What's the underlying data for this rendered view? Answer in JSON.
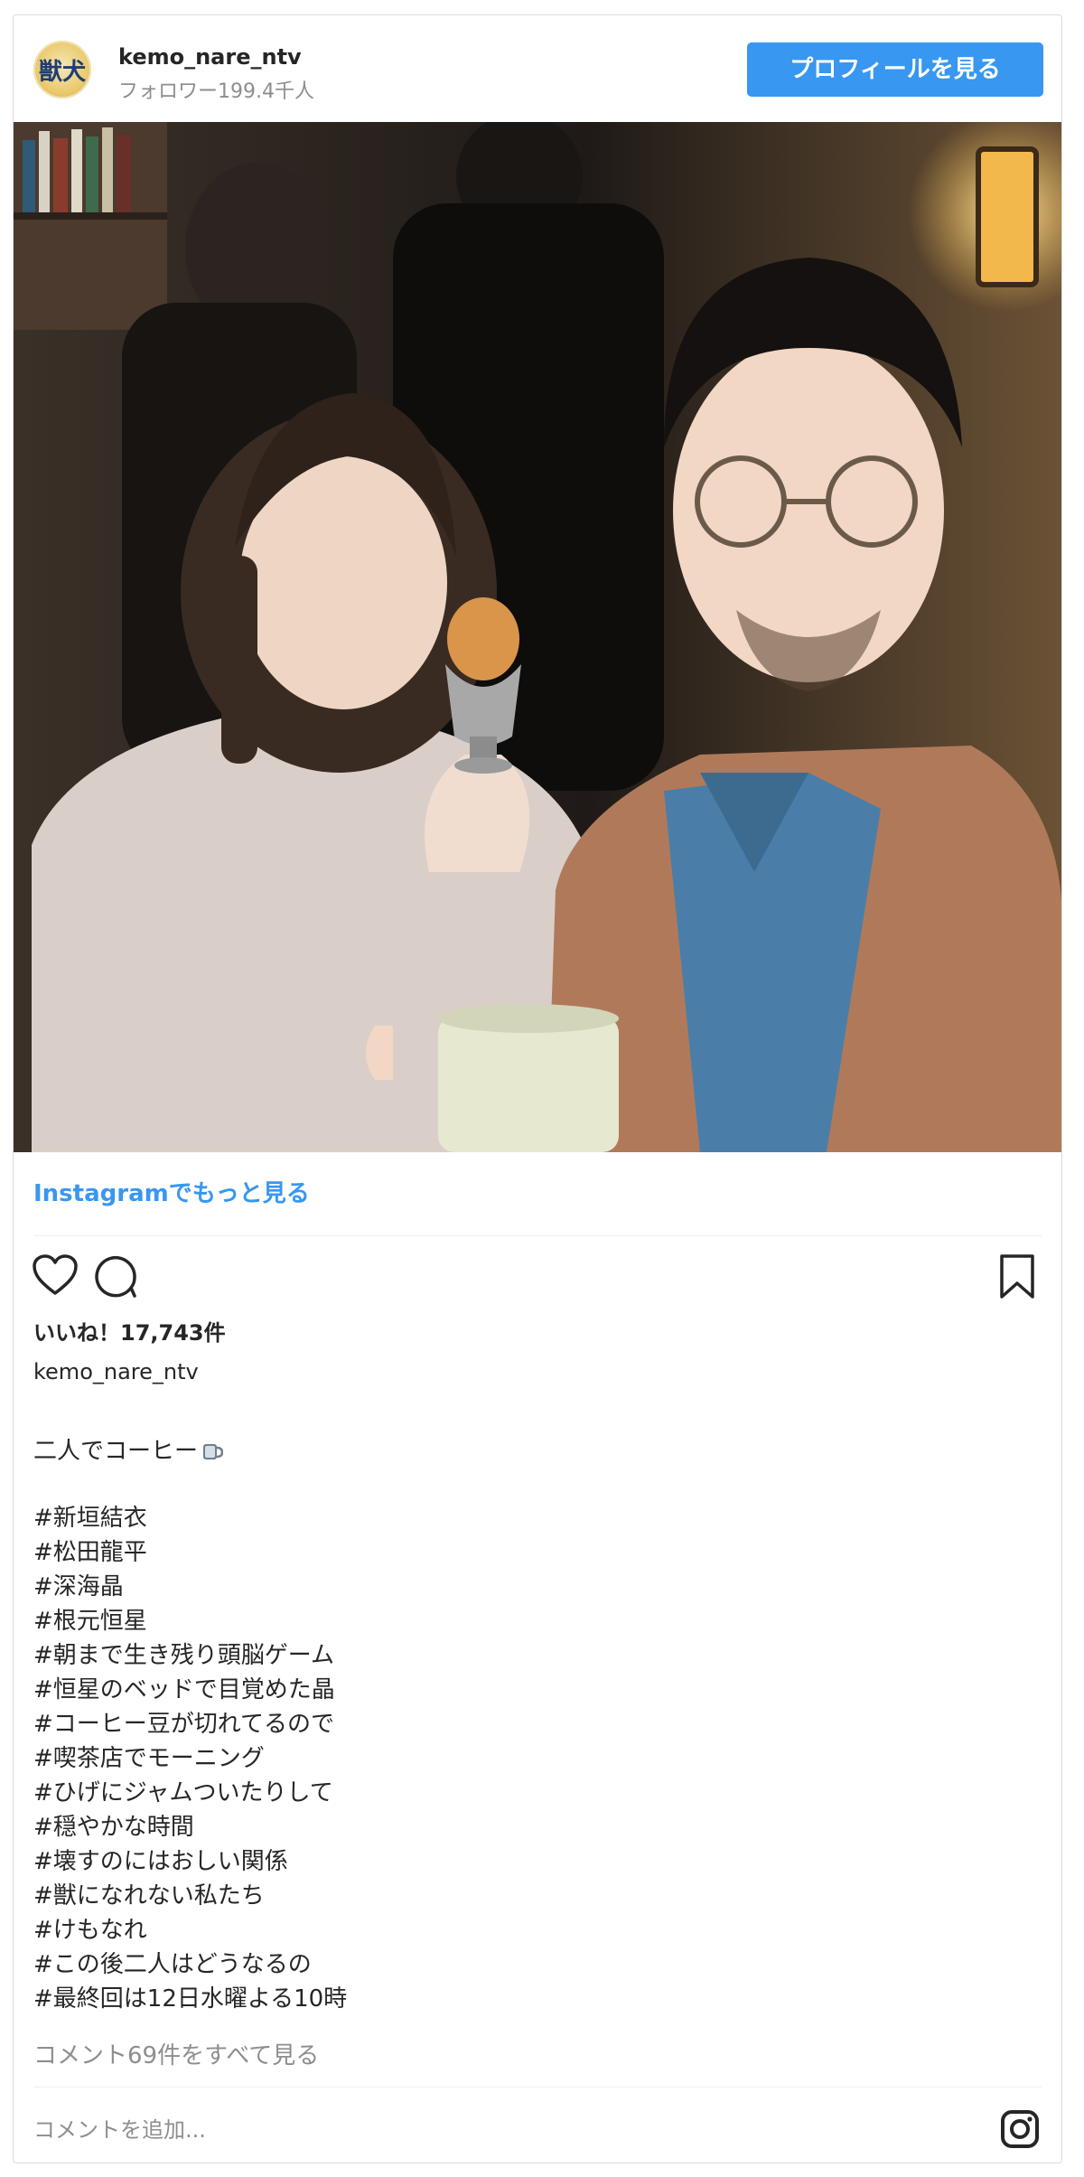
{
  "header": {
    "avatar_text": "獣犬",
    "username": "kemo_nare_ntv",
    "followers": "フォロワー199.4千人",
    "profile_button": "プロフィールを見る"
  },
  "photo": {
    "alt": "Selfie of a woman holding an egg cup and a man holding a coffee mug in a cafe",
    "colors": {
      "background": "#2a2420",
      "lamp": "#f2b84b",
      "jacket": "#b07a5a",
      "shirt": "#4a7ea8",
      "sweater": "#d9cfc8"
    }
  },
  "more_link": "Instagramでもっと見る",
  "actions": {
    "like_icon": "heart-icon",
    "comment_icon": "comment-icon",
    "save_icon": "bookmark-icon"
  },
  "likes": "いいね！17,743件",
  "caption": {
    "user": "kemo_nare_ntv",
    "text": "二人でコーヒー",
    "emoji": "mug-icon",
    "hashtags": [
      "#新垣結衣",
      "#松田龍平",
      "#深海晶",
      "#根元恒星",
      "#朝まで生き残り頭脳ゲーム",
      "#恒星のベッドで目覚めた晶",
      "#コーヒー豆が切れてるので",
      "#喫茶店でモーニング",
      "#ひげにジャムついたりして",
      "#穏やかな時間",
      "#壊すのにはおしい関係",
      "#獣になれない私たち",
      "#けもなれ",
      "#この後二人はどうなるの",
      "#最終回は12日水曜よる10時"
    ]
  },
  "view_comments": "コメント69件をすべて見る",
  "comment": {
    "placeholder": "コメントを追加...",
    "instagram_icon": "instagram-icon"
  },
  "accent": "#3897f0"
}
